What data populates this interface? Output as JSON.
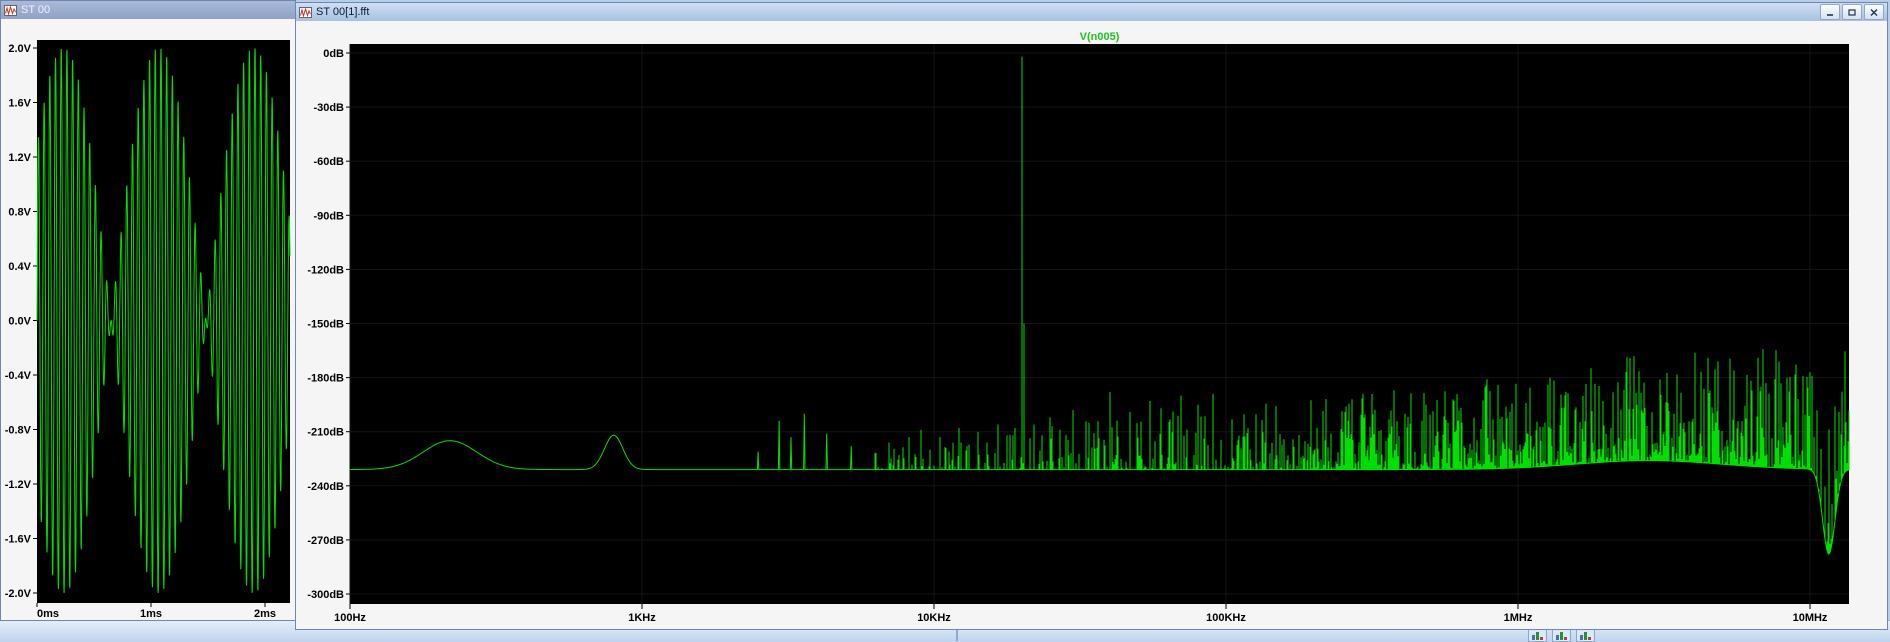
{
  "colors": {
    "trace": "#00E000",
    "fft_title": "#1EC41E",
    "plot_background": "#000000"
  },
  "windows": {
    "time": {
      "title": "ST 00",
      "active": false
    },
    "fft": {
      "title": "ST 00[1].fft",
      "active": true,
      "controls": [
        "minimize",
        "maximize",
        "close"
      ]
    }
  },
  "chart_data": [
    {
      "id": "time-domain",
      "type": "line",
      "window_title": "ST 00",
      "title": "",
      "x_ticks": [
        "0ms",
        "1ms",
        "2ms"
      ],
      "y_ticks": [
        "2.0V",
        "1.6V",
        "1.2V",
        "0.8V",
        "0.4V",
        "0.0V",
        "-0.4V",
        "-0.8V",
        "-1.2V",
        "-1.6V",
        "-2.0V"
      ],
      "x_range": {
        "unit": "ms",
        "min": 0,
        "max": 2.22
      },
      "y_range": {
        "unit": "V",
        "min": -2.0,
        "max": 2.0
      },
      "grid": false,
      "series": [
        {
          "name": "time-domain trace",
          "signal_model": {
            "kind": "amplitude-modulated-sine",
            "carrier_hz": 20000,
            "modulation_hz": 600,
            "modulation_phase_rad": 0.69,
            "peak_amplitude_v": 2.0
          }
        }
      ]
    },
    {
      "id": "fft",
      "type": "line",
      "window_title": "ST 00[1].fft",
      "title": "V(n005)",
      "x_scale": "log",
      "x_ticks": [
        "100Hz",
        "1KHz",
        "10KHz",
        "100KHz",
        "1MHz",
        "10MHz"
      ],
      "y_ticks": [
        "0dB",
        "-30dB",
        "-60dB",
        "-90dB",
        "-120dB",
        "-150dB",
        "-180dB",
        "-210dB",
        "-240dB",
        "-270dB",
        "-300dB"
      ],
      "x_range": {
        "unit": "Hz",
        "min": 100,
        "max": 13600000
      },
      "y_range": {
        "unit": "dB",
        "min": -300,
        "max": 0
      },
      "noise_floor_db": -231,
      "features": {
        "low_freq_hump": {
          "center_hz": 220,
          "height_db": 16,
          "width_decades": 0.13
        },
        "tone_800hz": {
          "center_hz": 800,
          "height_db": 19,
          "width_decades": 0.045
        },
        "fundamental": {
          "freq_hz": 20000,
          "peak_db": -2
        },
        "hf_noise": {
          "start_hz": 6000,
          "top_db_at_10mhz": -163
        },
        "notch": {
          "center_hz": 11600000,
          "depth_db": -47,
          "width_decades": 0.03
        },
        "bottom_rise": {
          "center_hz": 2800000,
          "height_db": 5,
          "width_decades": 0.35
        }
      },
      "spikes_hz_db": [
        [
          2500,
          -221
        ],
        [
          2950,
          -204
        ],
        [
          3250,
          -213
        ],
        [
          3600,
          -200
        ],
        [
          4300,
          -211
        ],
        [
          5200,
          -218
        ],
        [
          6300,
          -222
        ],
        [
          7000,
          -216
        ],
        [
          7600,
          -223
        ],
        [
          8200,
          -213
        ],
        [
          9000,
          -209
        ],
        [
          9700,
          -220
        ],
        [
          10500,
          -213
        ],
        [
          11300,
          -221
        ],
        [
          12200,
          -208
        ],
        [
          13000,
          -218
        ],
        [
          14100,
          -210
        ],
        [
          15200,
          -216
        ],
        [
          16500,
          -206
        ],
        [
          17800,
          -212
        ],
        [
          19000,
          -208
        ],
        [
          20000,
          -2
        ],
        [
          20300,
          -150
        ],
        [
          22000,
          -206
        ],
        [
          23500,
          -212
        ],
        [
          25000,
          -202
        ],
        [
          27000,
          -209
        ],
        [
          30000,
          -198
        ],
        [
          34000,
          -205
        ],
        [
          40000,
          -188
        ],
        [
          47000,
          -199
        ],
        [
          55000,
          -193
        ],
        [
          60000,
          -197
        ],
        [
          70000,
          -190
        ],
        [
          80000,
          -195
        ],
        [
          90000,
          -189
        ]
      ]
    }
  ]
}
